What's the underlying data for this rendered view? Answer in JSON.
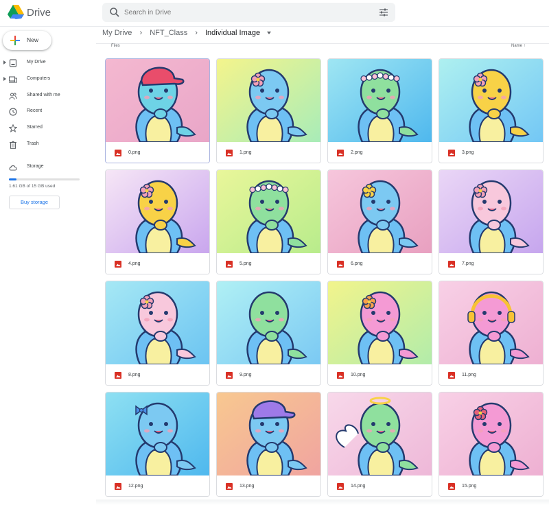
{
  "app": {
    "name": "Drive"
  },
  "search": {
    "placeholder": "Search in Drive"
  },
  "sidebar": {
    "new_label": "New",
    "items": [
      {
        "label": "My Drive",
        "icon": "my-drive-icon",
        "caret": true
      },
      {
        "label": "Computers",
        "icon": "computer-icon",
        "caret": true
      },
      {
        "label": "Shared with me",
        "icon": "shared-icon",
        "caret": false
      },
      {
        "label": "Recent",
        "icon": "clock-icon",
        "caret": false
      },
      {
        "label": "Starred",
        "icon": "star-icon",
        "caret": false
      },
      {
        "label": "Trash",
        "icon": "trash-icon",
        "caret": false
      }
    ],
    "storage_label": "Storage",
    "storage_used_text": "1.61 GB of 15 GB used",
    "storage_fraction": 0.107,
    "buy_label": "Buy storage"
  },
  "breadcrumb": {
    "root": "My Drive",
    "parent": "NFT_Class",
    "current": "Individual Image"
  },
  "list": {
    "files_label": "Files",
    "sort_label": "Name"
  },
  "files": [
    {
      "name": "0.png",
      "bg": [
        "#f4b8d0",
        "#e9a6c8"
      ],
      "body": "#6ed3e6",
      "accessory": "cap",
      "accessory_color": "#e94d6b"
    },
    {
      "name": "1.png",
      "bg": [
        "#f4f48c",
        "#a8ecb8"
      ],
      "body": "#7cc9f2",
      "accessory": "flower",
      "accessory_color": "#f3a0b8"
    },
    {
      "name": "2.png",
      "bg": [
        "#9fe6f3",
        "#4fb8ee"
      ],
      "body": "#8fe09e",
      "accessory": "wreath",
      "accessory_color": "#f9c1d6"
    },
    {
      "name": "3.png",
      "bg": [
        "#aef0f0",
        "#73c7f5"
      ],
      "body": "#f8d247",
      "accessory": "flower",
      "accessory_color": "#f3a0b8"
    },
    {
      "name": "4.png",
      "bg": [
        "#f6e6f6",
        "#c9a6ee"
      ],
      "body": "#f8d247",
      "accessory": "flower",
      "accessory_color": "#f3a0b8"
    },
    {
      "name": "5.png",
      "bg": [
        "#e9f69a",
        "#b8ec8c"
      ],
      "body": "#8fe09e",
      "accessory": "wreath",
      "accessory_color": "#f9c1d6"
    },
    {
      "name": "6.png",
      "bg": [
        "#f6c6dc",
        "#e8a0c0"
      ],
      "body": "#7cc9f2",
      "accessory": "flower",
      "accessory_color": "#f8d247"
    },
    {
      "name": "7.png",
      "bg": [
        "#ead6f6",
        "#c6a6ee"
      ],
      "body": "#f8c8dc",
      "accessory": "flower",
      "accessory_color": "#f3a0b8"
    },
    {
      "name": "8.png",
      "bg": [
        "#a6e8f4",
        "#6cc4f2"
      ],
      "body": "#f8c8dc",
      "accessory": "flower",
      "accessory_color": "#f3a0b8"
    },
    {
      "name": "9.png",
      "bg": [
        "#b0f0f4",
        "#7bc9f3"
      ],
      "body": "#8fe09e",
      "accessory": "none",
      "accessory_color": "#ffffff"
    },
    {
      "name": "10.png",
      "bg": [
        "#f2f48c",
        "#b2ecaa"
      ],
      "body": "#f49ad4",
      "accessory": "flower",
      "accessory_color": "#f8a04a"
    },
    {
      "name": "11.png",
      "bg": [
        "#f8d0e6",
        "#eeb0d2"
      ],
      "body": "#f49ad4",
      "accessory": "headphones",
      "accessory_color": "#f8c235"
    },
    {
      "name": "12.png",
      "bg": [
        "#8ee0f2",
        "#4fb8ee"
      ],
      "body": "#7cc9f2",
      "accessory": "bow",
      "accessory_color": "#4c8fe8"
    },
    {
      "name": "13.png",
      "bg": [
        "#f8c890",
        "#f0a4a0"
      ],
      "body": "#7cc9f2",
      "accessory": "cap",
      "accessory_color": "#9e7ae8"
    },
    {
      "name": "14.png",
      "bg": [
        "#f8d8ea",
        "#eeb8d8"
      ],
      "body": "#8fe09e",
      "accessory": "halo",
      "accessory_color": "#f8d247"
    },
    {
      "name": "15.png",
      "bg": [
        "#f8d0e6",
        "#eeb0d2"
      ],
      "body": "#f49ad4",
      "accessory": "flower",
      "accessory_color": "#e8607a"
    }
  ]
}
